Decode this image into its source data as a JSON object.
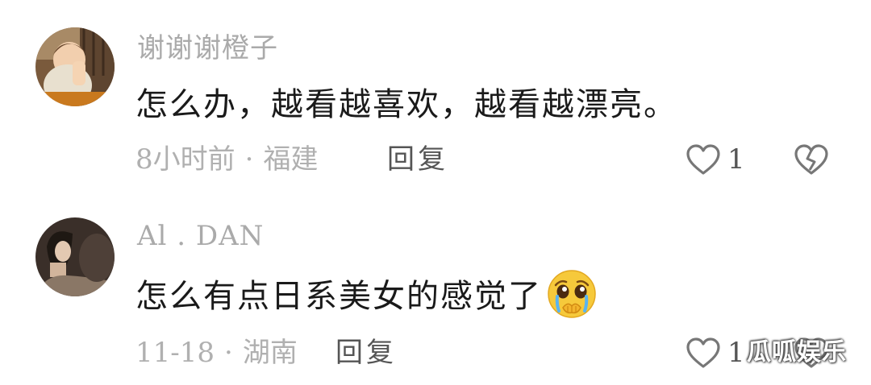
{
  "comments": [
    {
      "username": "谢谢谢橙子",
      "text": "怎么办，越看越喜欢，越看越漂亮。",
      "time": "8小时前",
      "separator": "·",
      "location": "福建",
      "reply_label": "回复",
      "like_count": "1",
      "avatar_icon": "avatar-photo-child",
      "like_icon": "heart-outline-icon",
      "dislike_icon": "broken-heart-icon"
    },
    {
      "username": "Al . DAN",
      "text": "怎么有点日系美女的感觉了",
      "emoji_icon": "pleading-face-emoji",
      "time": "11-18",
      "separator": "·",
      "location": "湖南",
      "reply_label": "回复",
      "like_count": "1",
      "avatar_icon": "avatar-photo-woman",
      "like_icon": "heart-outline-icon",
      "dislike_icon": "broken-heart-icon"
    }
  ],
  "watermark": "瓜呱娱乐",
  "colors": {
    "username": "#aaaaaa",
    "comment_text": "#1a1a1a",
    "meta": "#b0b0b0",
    "reply": "#555555",
    "icon": "#777777"
  }
}
